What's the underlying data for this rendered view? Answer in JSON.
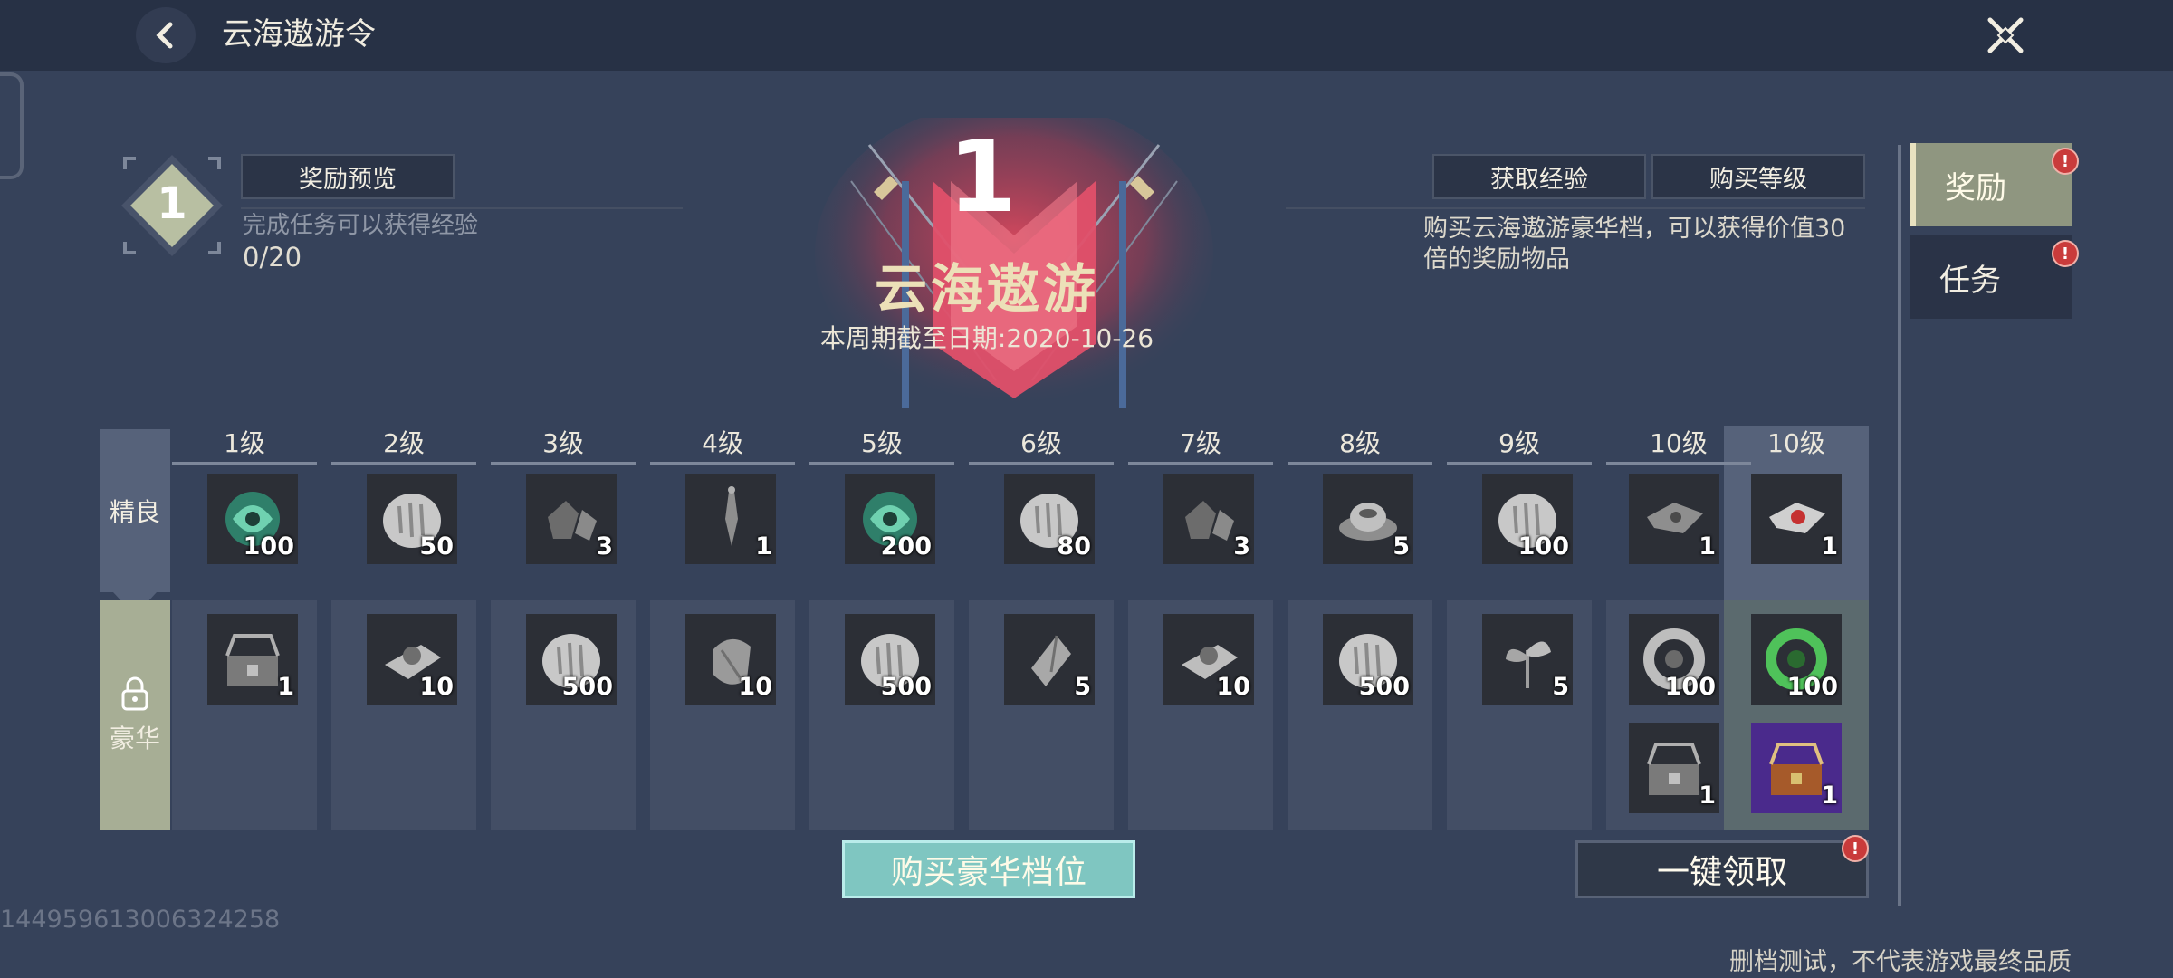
{
  "header": {
    "title": "云海遨游令"
  },
  "pass": {
    "level": "1",
    "preview_label": "奖励预览",
    "hint": "完成任务可以获得经验",
    "progress": "0/20",
    "emblem_level": "1",
    "emblem_title": "云海遨游",
    "deadline": "本周期截至日期:2020-10-26",
    "get_exp_label": "获取经验",
    "buy_level_label": "购买等级",
    "luxury_desc": "购买云海遨游豪华档，可以获得价值30倍的奖励物品"
  },
  "side_tabs": [
    {
      "label": "奖励",
      "active": true,
      "alert": "!"
    },
    {
      "label": "任务",
      "active": false,
      "alert": "!"
    }
  ],
  "rows": {
    "normal_label": "精良",
    "luxury_label": "豪华"
  },
  "levels": [
    {
      "label": "1级",
      "normal": {
        "icon": "jade-orb-icon",
        "count": "100"
      },
      "luxury": [
        {
          "icon": "chest-icon",
          "count": "1"
        }
      ]
    },
    {
      "label": "2级",
      "normal": {
        "icon": "silver-ingot-icon",
        "count": "50"
      },
      "luxury": [
        {
          "icon": "silk-bundle-icon",
          "count": "10"
        }
      ]
    },
    {
      "label": "3级",
      "normal": {
        "icon": "ore-icon",
        "count": "3"
      },
      "luxury": [
        {
          "icon": "silver-ingot-icon",
          "count": "500"
        }
      ]
    },
    {
      "label": "4级",
      "normal": {
        "icon": "pendant-icon",
        "count": "1"
      },
      "luxury": [
        {
          "icon": "stone-icon",
          "count": "10"
        }
      ]
    },
    {
      "label": "5级",
      "normal": {
        "icon": "jade-orb-icon",
        "count": "200"
      },
      "luxury": [
        {
          "icon": "silver-ingot-icon",
          "count": "500"
        }
      ]
    },
    {
      "label": "6级",
      "normal": {
        "icon": "silver-ingot-icon",
        "count": "80"
      },
      "luxury": [
        {
          "icon": "crystal-icon",
          "count": "5"
        }
      ]
    },
    {
      "label": "7级",
      "normal": {
        "icon": "ore-icon",
        "count": "3"
      },
      "luxury": [
        {
          "icon": "silk-bundle-icon",
          "count": "10"
        }
      ]
    },
    {
      "label": "8级",
      "normal": {
        "icon": "teacup-icon",
        "count": "5"
      },
      "luxury": [
        {
          "icon": "silver-ingot-icon",
          "count": "500"
        }
      ]
    },
    {
      "label": "9级",
      "normal": {
        "icon": "silver-ingot-icon",
        "count": "100"
      },
      "luxury": [
        {
          "icon": "herb-icon",
          "count": "5"
        }
      ]
    },
    {
      "label": "10级",
      "normal": {
        "icon": "cloth-icon",
        "count": "1"
      },
      "luxury": [
        {
          "icon": "ring-amulet-icon",
          "count": "100"
        },
        {
          "icon": "chest-icon",
          "count": "1"
        }
      ]
    },
    {
      "label": "10级",
      "normal": {
        "icon": "cloth-red-icon",
        "count": "1"
      },
      "luxury": [
        {
          "icon": "green-ring-amulet-icon",
          "count": "100"
        },
        {
          "icon": "purple-chest-icon",
          "count": "1"
        }
      ]
    }
  ],
  "actions": {
    "buy_luxury_label": "购买豪华档位",
    "claim_all_label": "一键领取",
    "claim_alert": "!"
  },
  "footer": {
    "uid": "144959613006324258",
    "notice": "删档测试，不代表游戏最终品质"
  },
  "colors": {
    "background": "#36425a",
    "topbar": "#273145",
    "accent_teal": "#7fc6c1",
    "alert_red": "#c93b3b",
    "emblem_red": "#d84a5c"
  }
}
